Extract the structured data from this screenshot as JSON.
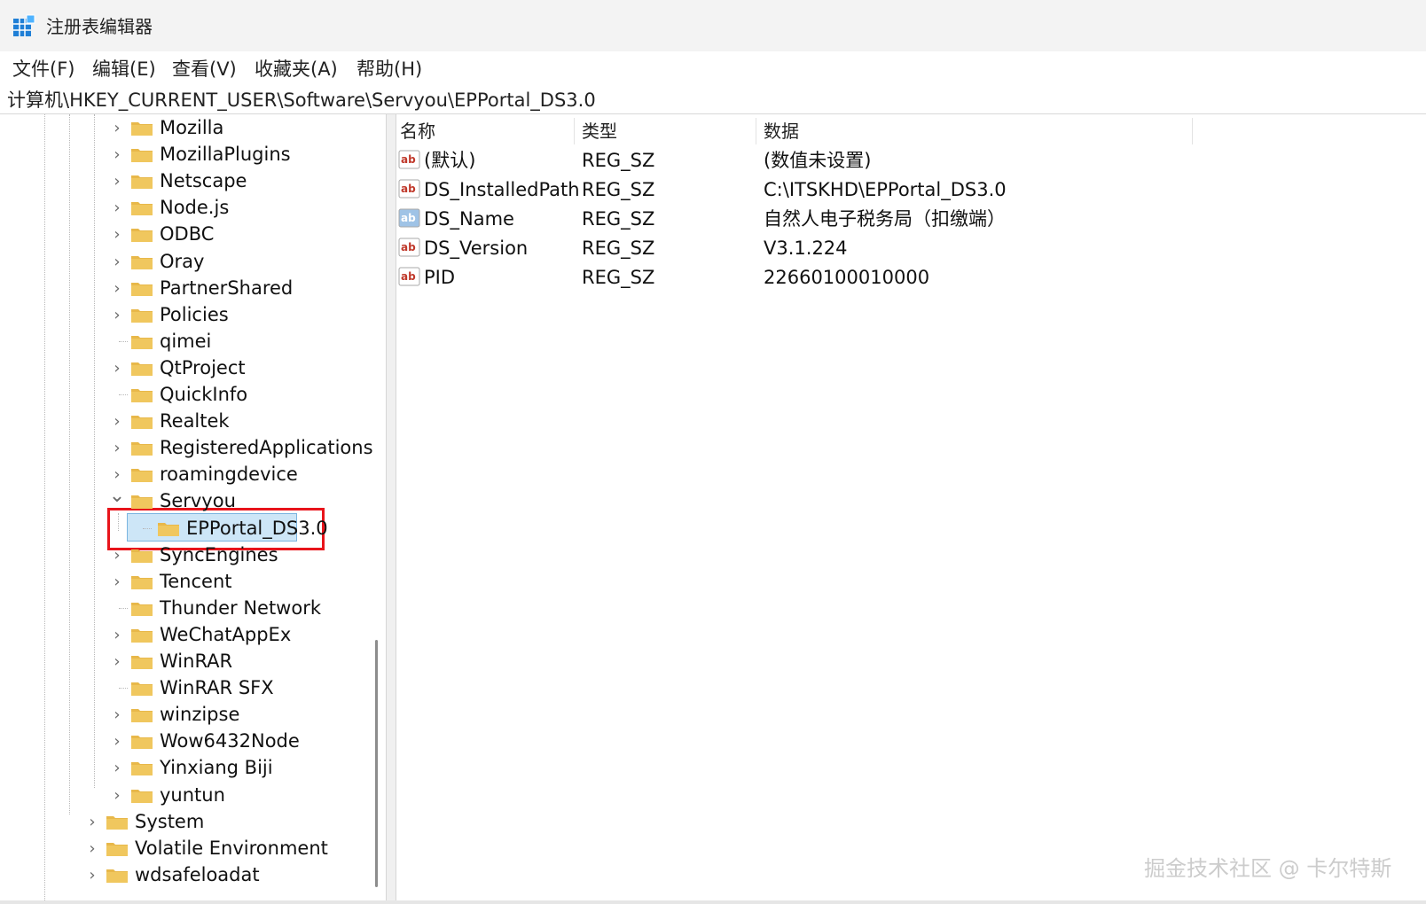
{
  "window": {
    "title": "注册表编辑器",
    "icon": "regedit-icon"
  },
  "menu": [
    {
      "label": "文件(F)"
    },
    {
      "label": "编辑(E)"
    },
    {
      "label": "查看(V)"
    },
    {
      "label": "收藏夹(A)"
    },
    {
      "label": "帮助(H)"
    }
  ],
  "address": "计算机\\HKEY_CURRENT_USER\\Software\\Servyou\\EPPortal_DS3.0",
  "tree": {
    "nodes": [
      {
        "label": "Mozilla",
        "expander": "collapsed"
      },
      {
        "label": "MozillaPlugins",
        "expander": "collapsed"
      },
      {
        "label": "Netscape",
        "expander": "collapsed"
      },
      {
        "label": "Node.js",
        "expander": "collapsed"
      },
      {
        "label": "ODBC",
        "expander": "collapsed"
      },
      {
        "label": "Oray",
        "expander": "collapsed"
      },
      {
        "label": "PartnerShared",
        "expander": "collapsed"
      },
      {
        "label": "Policies",
        "expander": "collapsed"
      },
      {
        "label": "qimei",
        "expander": "none"
      },
      {
        "label": "QtProject",
        "expander": "collapsed"
      },
      {
        "label": "QuickInfo",
        "expander": "none"
      },
      {
        "label": "Realtek",
        "expander": "collapsed"
      },
      {
        "label": "RegisteredApplications",
        "expander": "collapsed"
      },
      {
        "label": "roamingdevice",
        "expander": "collapsed"
      },
      {
        "label": "Servyou",
        "expander": "expanded"
      },
      {
        "label": "EPPortal_DS3.0",
        "expander": "none",
        "selected": true
      },
      {
        "label": "SyncEngines",
        "expander": "collapsed"
      },
      {
        "label": "Tencent",
        "expander": "collapsed"
      },
      {
        "label": "Thunder Network",
        "expander": "none"
      },
      {
        "label": "WeChatAppEx",
        "expander": "collapsed"
      },
      {
        "label": "WinRAR",
        "expander": "collapsed"
      },
      {
        "label": "WinRAR SFX",
        "expander": "none"
      },
      {
        "label": "winzipse",
        "expander": "collapsed"
      },
      {
        "label": "Wow6432Node",
        "expander": "collapsed"
      },
      {
        "label": "Yinxiang Biji",
        "expander": "collapsed"
      },
      {
        "label": "yuntun",
        "expander": "collapsed"
      },
      {
        "label": "System",
        "expander": "collapsed"
      },
      {
        "label": "Volatile Environment",
        "expander": "collapsed"
      },
      {
        "label": "wdsafeloadat",
        "expander": "collapsed"
      }
    ]
  },
  "values": {
    "headers": {
      "name": "名称",
      "type": "类型",
      "data": "数据"
    },
    "rows": [
      {
        "name": "(默认)",
        "type": "REG_SZ",
        "data": "(数值未设置)"
      },
      {
        "name": "DS_InstalledPath",
        "type": "REG_SZ",
        "data": "C:\\ITSKHD\\EPPortal_DS3.0"
      },
      {
        "name": "DS_Name",
        "type": "REG_SZ",
        "data": "自然人电子税务局（扣缴端）"
      },
      {
        "name": "DS_Version",
        "type": "REG_SZ",
        "data": "V3.1.224"
      },
      {
        "name": "PID",
        "type": "REG_SZ",
        "data": "22660100010000"
      }
    ]
  },
  "watermark": "掘金技术社区 @ 卡尔特斯",
  "colors": {
    "highlight_border": "#e8141b",
    "folder": "#f0c75e",
    "selection": "#cde6f7",
    "string_icon": "#c0392b"
  }
}
